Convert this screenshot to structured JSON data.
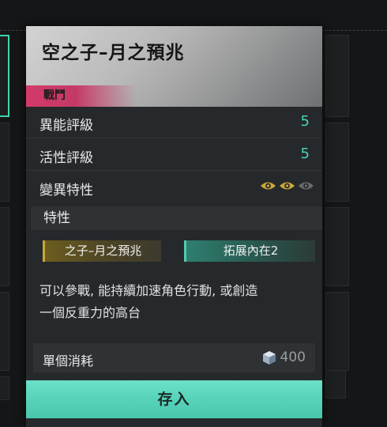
{
  "card": {
    "title": "空之子–月之預兆",
    "tag": "戰鬥",
    "rows": [
      {
        "label": "異能評級",
        "value": "5"
      },
      {
        "label": "活性評級",
        "value": "5"
      },
      {
        "label": "變異特性"
      }
    ],
    "mutation_level": {
      "filled": 2,
      "total": 3
    },
    "trait_section_label": "特性",
    "traits": [
      "之子–月之預兆",
      "拓展內在2"
    ],
    "description_lines": [
      "可以參戰, 能持續加速角色行動, 或創造",
      "一個反重力的高台"
    ],
    "cost": {
      "label": "單個消耗",
      "amount": "400",
      "icon": "cube-icon"
    },
    "store_button": "存入"
  },
  "colors": {
    "accent_teal": "#47d3b8",
    "battle_tag": "#d43a69",
    "eye_gold": "#c9a83a",
    "eye_dim": "#6a6c6e"
  }
}
